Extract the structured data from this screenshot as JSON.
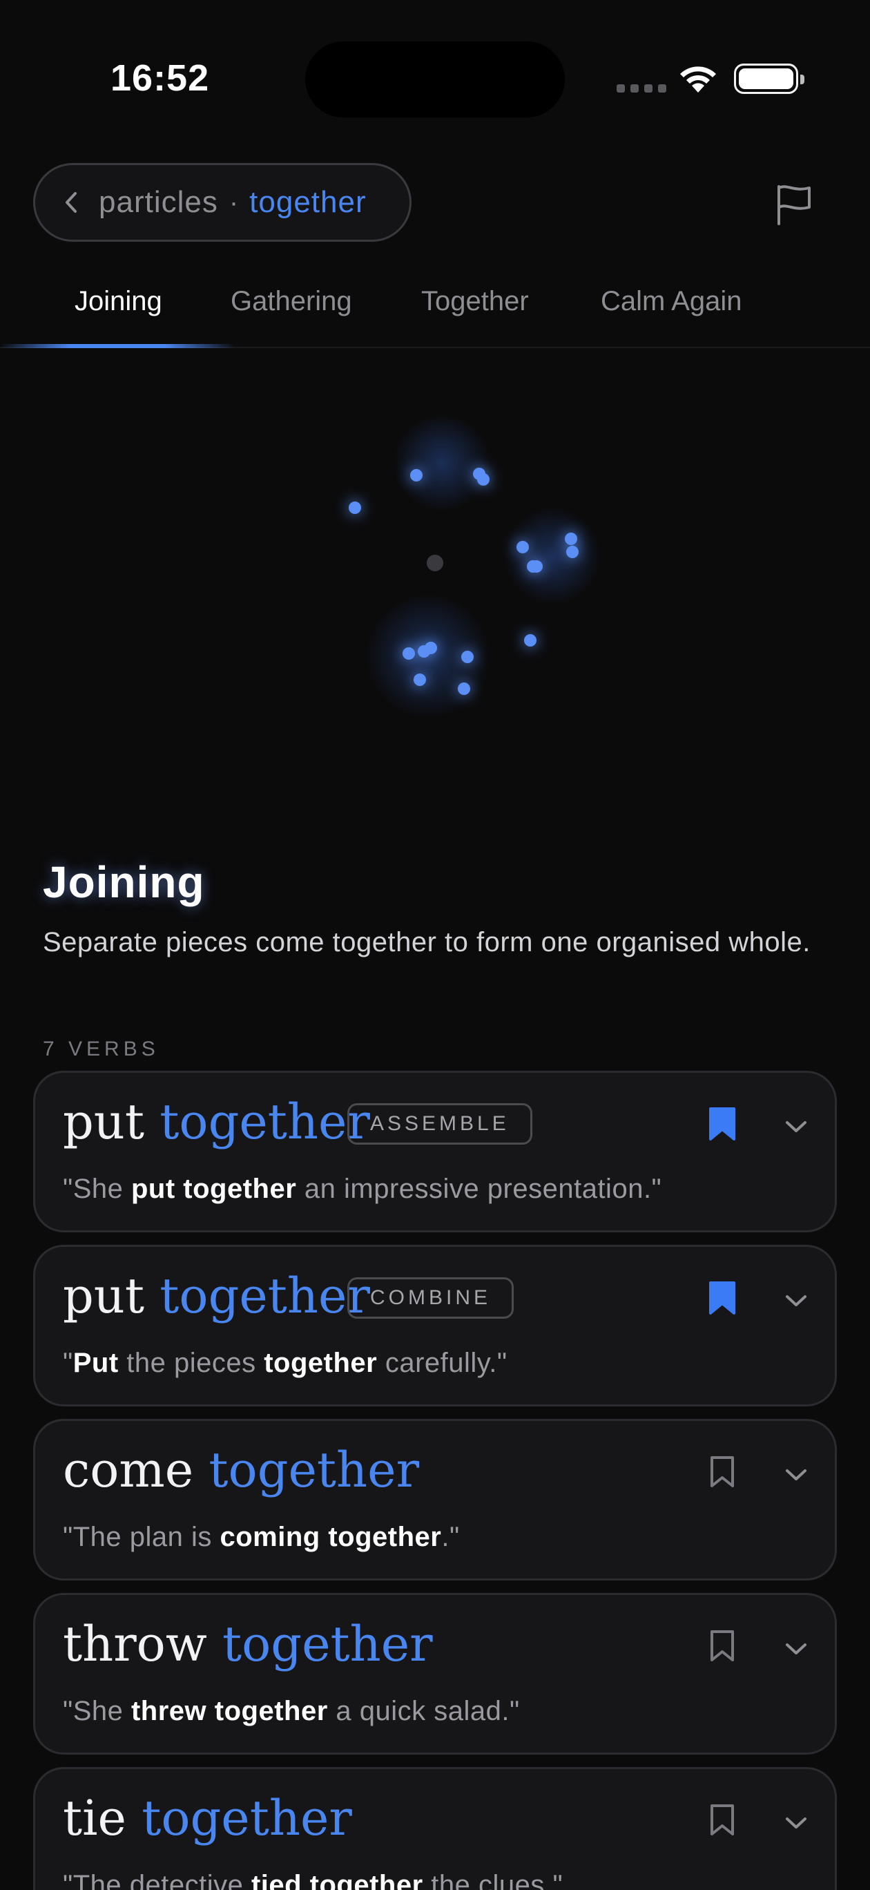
{
  "status_bar": {
    "time": "16:52"
  },
  "breadcrumb": {
    "parent": "particles",
    "separator": "·",
    "current": "together"
  },
  "tabs": [
    {
      "label": "Joining",
      "active": true
    },
    {
      "label": "Gathering",
      "active": false
    },
    {
      "label": "Together",
      "active": false
    },
    {
      "label": "Calm Again",
      "active": false
    }
  ],
  "section": {
    "title": "Joining",
    "description": "Separate pieces come together to form one organised whole.",
    "verb_count": "7 VERBS"
  },
  "verbs": [
    {
      "base": "put",
      "particle": "together",
      "tag": "ASSEMBLE",
      "bookmarked": true,
      "example": {
        "pre": "\"She ",
        "bold1": "put together",
        "mid": " an impressive presentation.\"",
        "bold2": "",
        "post": ""
      }
    },
    {
      "base": "put",
      "particle": "together",
      "tag": "COMBINE",
      "bookmarked": true,
      "example": {
        "pre": "\"",
        "bold1": "Put",
        "mid": " the pieces ",
        "bold2": "together",
        "post": " carefully.\""
      }
    },
    {
      "base": "come",
      "particle": "together",
      "tag": "",
      "bookmarked": false,
      "example": {
        "pre": "\"The plan is ",
        "bold1": "coming together",
        "mid": ".\"",
        "bold2": "",
        "post": ""
      }
    },
    {
      "base": "throw",
      "particle": "together",
      "tag": "",
      "bookmarked": false,
      "example": {
        "pre": "\"She ",
        "bold1": "threw together",
        "mid": " a quick salad.\"",
        "bold2": "",
        "post": ""
      }
    },
    {
      "base": "tie",
      "particle": "together",
      "tag": "",
      "bookmarked": false,
      "example": {
        "pre": "\"The detective ",
        "bold1": "tied together",
        "mid": " the clues.\"",
        "bold2": "",
        "post": ""
      }
    }
  ],
  "colors": {
    "background": "#0b0b0c",
    "accent": "#4a86f0",
    "card": "#161618",
    "text_muted": "#8e8e93"
  },
  "icons": [
    "back-chevron-icon",
    "flag-icon",
    "bookmark-icon",
    "chevron-down-icon",
    "wifi-icon",
    "battery-icon"
  ]
}
